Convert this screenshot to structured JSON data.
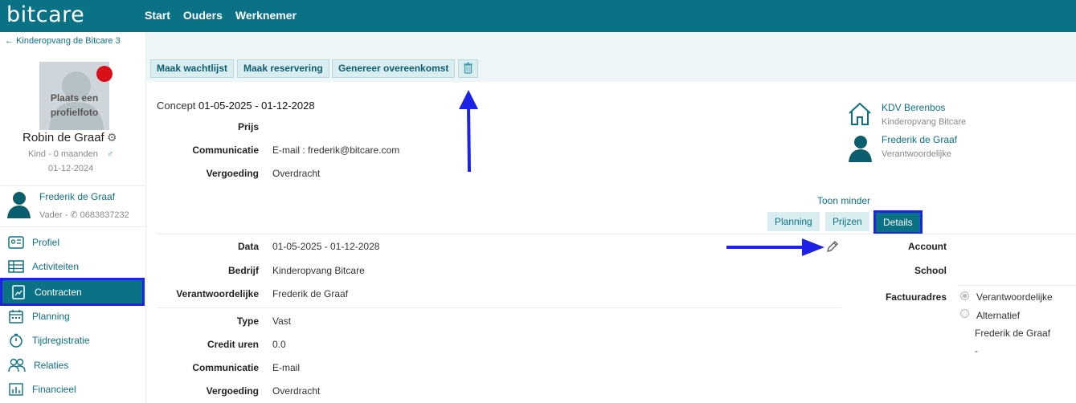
{
  "header": {
    "logo": "bitcare",
    "nav": [
      "Start",
      "Ouders",
      "Werknemer"
    ]
  },
  "sidebar": {
    "back_label": "Kinderopvang de Bitcare 3",
    "avatar_text_1": "Plaats een",
    "avatar_text_2": "profielfoto",
    "child_name": "Robin de Graaf",
    "child_info": "Kind - 0 maanden",
    "child_gender": "♂",
    "child_date": "01-12-2024",
    "parent_name": "Frederik de Graaf",
    "parent_role": "Vader -",
    "parent_phone": "0683837232",
    "menu": [
      "Profiel",
      "Activiteiten",
      "Contracten",
      "Planning",
      "Tijdregistratie",
      "Relaties",
      "Financieel"
    ]
  },
  "toolbar": {
    "waitlist": "Maak wachtlijst",
    "reservation": "Maak reservering",
    "agreement": "Genereer overeenkomst"
  },
  "contract": {
    "status": "Concept",
    "period": "01-05-2025 - 01-12-2028",
    "fields": [
      {
        "label": "Prijs",
        "value": ""
      },
      {
        "label": "Communicatie",
        "value": "E-mail : frederik@bitcare.com"
      },
      {
        "label": "Vergoeding",
        "value": "Overdracht"
      }
    ]
  },
  "side_info": {
    "org_name": "KDV Berenbos",
    "org_sub": "Kinderopvang Bitcare",
    "person_name": "Frederik de Graaf",
    "person_sub": "Verantwoordelijke"
  },
  "toggle": "Toon minder",
  "tabs": [
    "Planning",
    "Prijzen",
    "Details"
  ],
  "details": {
    "rows": [
      {
        "label": "Data",
        "value": "01-05-2025 - 01-12-2028"
      },
      {
        "label": "Bedrijf",
        "value": "Kinderopvang Bitcare"
      },
      {
        "label": "Verantwoordelijke",
        "value": "Frederik de Graaf"
      },
      {
        "label": "Type",
        "value": "Vast"
      },
      {
        "label": "Credit uren",
        "value": "0.0"
      },
      {
        "label": "Communicatie",
        "value": "E-mail"
      },
      {
        "label": "Vergoeding",
        "value": "Overdracht"
      }
    ],
    "account_label": "Account",
    "school_label": "School",
    "invoice_label": "Factuuradres",
    "invoice_options": [
      "Verantwoordelijke",
      "Alternatief"
    ],
    "invoice_name": "Frederik de Graaf",
    "invoice_extra": "-"
  },
  "colors": {
    "primary": "#0b7285",
    "highlight": "#1e22e6",
    "badge": "#d9101a"
  }
}
